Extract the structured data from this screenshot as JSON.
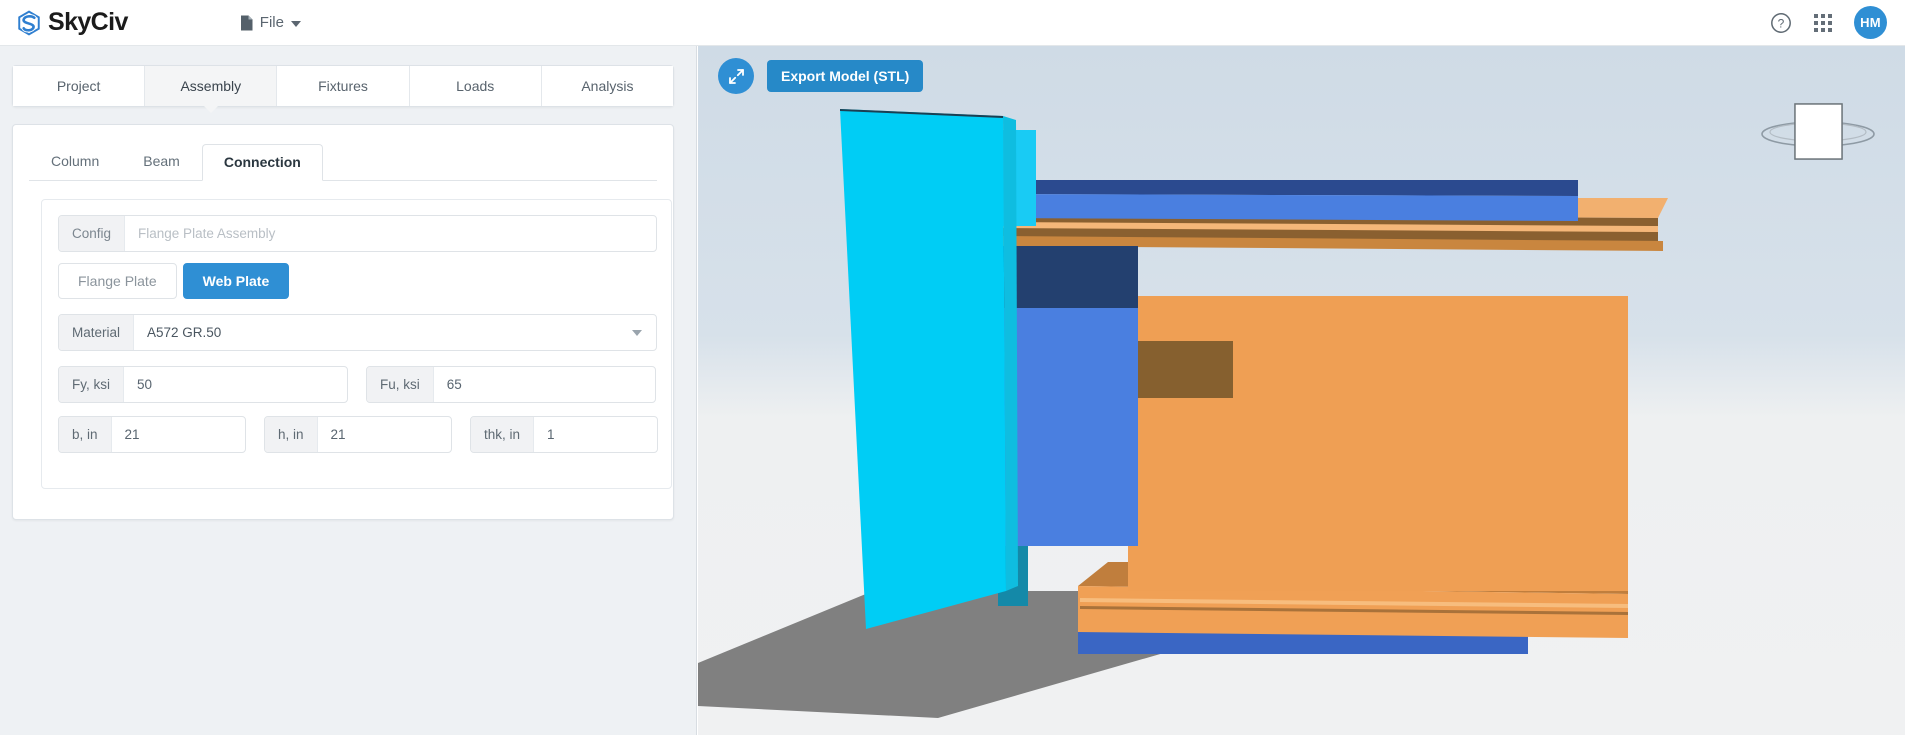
{
  "app": {
    "brand": "SkyCiv",
    "brand_icon": "skyciv-logo-icon",
    "accent_color": "#2f8fd4"
  },
  "topbar": {
    "file_menu": {
      "label": "File",
      "icon": "file-icon",
      "caret": "chevron-down-icon"
    },
    "help_icon": "question-circle-icon",
    "apps_icon": "grid-apps-icon",
    "avatar_initials": "HM"
  },
  "main_tabs": [
    {
      "label": "Project",
      "active": false
    },
    {
      "label": "Assembly",
      "active": true
    },
    {
      "label": "Fixtures",
      "active": false
    },
    {
      "label": "Loads",
      "active": false
    },
    {
      "label": "Analysis",
      "active": false
    }
  ],
  "sub_tabs": [
    {
      "label": "Column",
      "active": false
    },
    {
      "label": "Beam",
      "active": false
    },
    {
      "label": "Connection",
      "active": true
    }
  ],
  "connection_form": {
    "config": {
      "label": "Config",
      "value": "Flange Plate Assembly"
    },
    "plate_toggle": [
      {
        "label": "Flange Plate",
        "active": false
      },
      {
        "label": "Web Plate",
        "active": true
      }
    ],
    "material": {
      "label": "Material",
      "value": "A572 GR.50",
      "caret": "chevron-down-icon"
    },
    "fy": {
      "label": "Fy, ksi",
      "value": "50"
    },
    "fu": {
      "label": "Fu, ksi",
      "value": "65"
    },
    "b": {
      "label": "b, in",
      "value": "21"
    },
    "h": {
      "label": "h, in",
      "value": "21"
    },
    "thk": {
      "label": "thk, in",
      "value": "1"
    }
  },
  "viewport": {
    "fullscreen_button": {
      "icon": "expand-arrows-icon"
    },
    "export_button": {
      "label": "Export Model (STL)"
    },
    "view_cube": {
      "icon": "view-cube-orbit-icon"
    },
    "model": {
      "name": "steel-beam-column-connection-3d-model",
      "colors": {
        "column_cyan": "#00c8f0",
        "column_cyan_side": "#0fa8cc",
        "plate_blue": "#4a7fe0",
        "plate_blue_dark": "#2b4a8f",
        "plate_blue_mid": "#3a66c4",
        "beam_orange": "#f0a055",
        "beam_orange_dark": "#8a6030",
        "beam_orange_light": "#f7bd7e",
        "ground_shadow": "#808080"
      }
    }
  }
}
